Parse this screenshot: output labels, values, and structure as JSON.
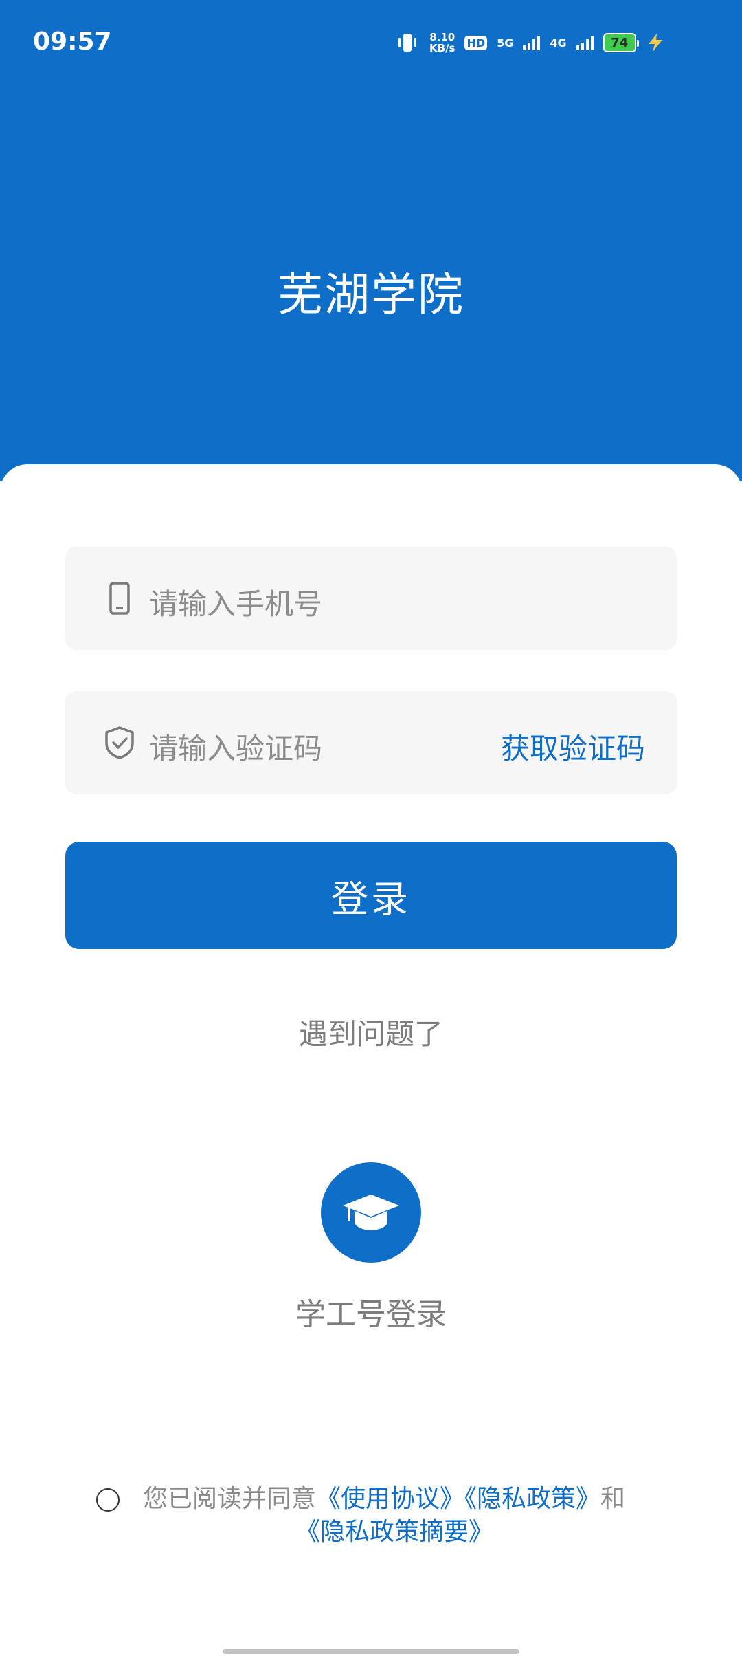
{
  "status_bar": {
    "time": "09:57",
    "net_speed_value": "8.10",
    "net_speed_unit": "KB/s",
    "hd_label": "HD",
    "sim_slots": "1 2",
    "network_5g": "5G",
    "network_4g": "4G",
    "battery_level": "74"
  },
  "header": {
    "title": "芜湖学院"
  },
  "form": {
    "phone_placeholder": "请输入手机号",
    "code_placeholder": "请输入验证码",
    "get_code_label": "获取验证码",
    "login_label": "登录",
    "trouble_label": "遇到问题了"
  },
  "alt_login": {
    "label": "学工号登录",
    "icon": "graduation-cap-icon"
  },
  "agreement": {
    "prefix": "您已阅读并同意",
    "terms_link": "《使用协议》",
    "privacy_link": "《隐私政策》",
    "and": "和",
    "summary_link": "《隐私政策摘要》"
  },
  "colors": {
    "primary": "#0e6ec8",
    "field_bg": "#f6f6f6",
    "muted_text": "#8c8c8c"
  }
}
